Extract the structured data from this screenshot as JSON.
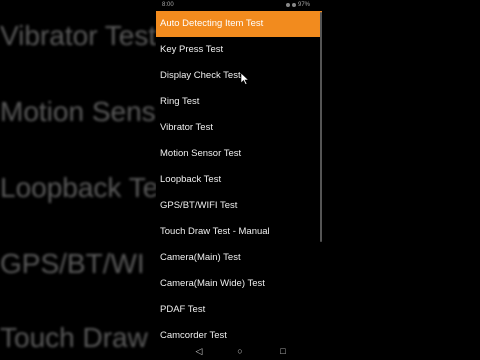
{
  "status_bar": {
    "time": "8:00",
    "battery": "97%"
  },
  "menu": {
    "items": [
      {
        "label": "Auto Detecting Item Test",
        "active": true
      },
      {
        "label": "Key Press Test"
      },
      {
        "label": "Display Check Test"
      },
      {
        "label": "Ring Test"
      },
      {
        "label": "Vibrator Test"
      },
      {
        "label": "Motion Sensor Test"
      },
      {
        "label": "Loopback Test"
      },
      {
        "label": "GPS/BT/WIFI Test"
      },
      {
        "label": "Touch Draw Test - Manual"
      },
      {
        "label": "Camera(Main) Test"
      },
      {
        "label": "Camera(Main Wide) Test"
      },
      {
        "label": "PDAF Test"
      },
      {
        "label": "Camcorder Test"
      }
    ]
  },
  "background": {
    "left": [
      "Vibrator Test",
      "Motion Sensor",
      "Loopback Te",
      "GPS/BT/WI",
      "Touch Draw"
    ]
  },
  "nav_bar": {
    "back_icon": "◁",
    "home_icon": "○",
    "recent_icon": "□"
  },
  "colors": {
    "accent": "#f28b1e",
    "background": "#000000",
    "text": "#f0f0f0"
  }
}
